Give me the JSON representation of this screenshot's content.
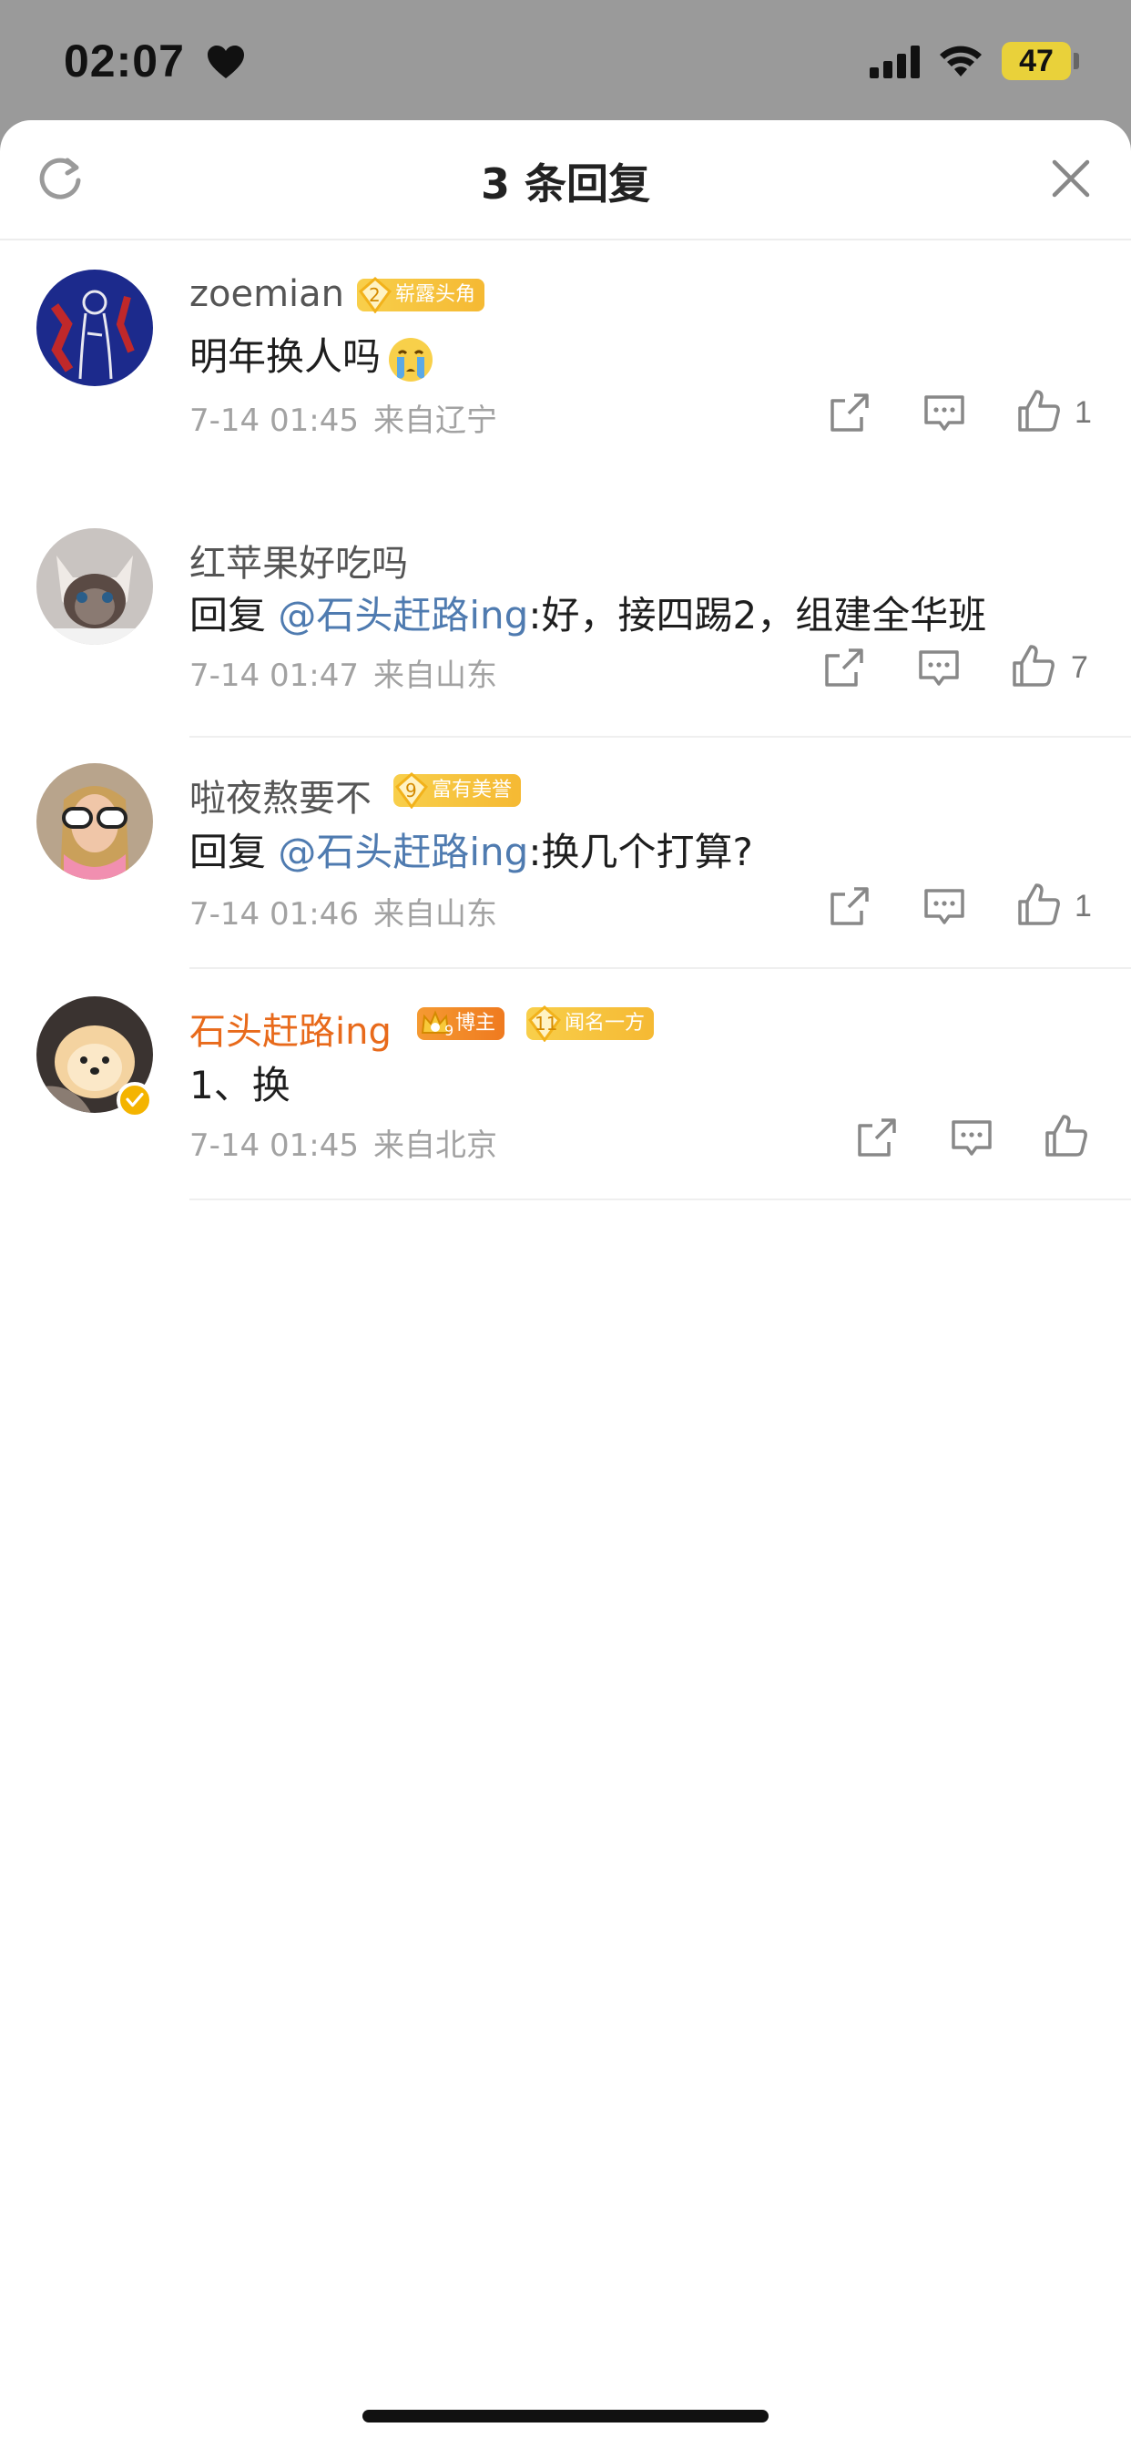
{
  "status_bar": {
    "time": "02:07",
    "battery": "47",
    "icons": [
      "heart-icon",
      "signal-icon",
      "wifi-icon",
      "battery-icon"
    ]
  },
  "header": {
    "title": "3 条回复",
    "refresh_icon": "refresh-icon",
    "close_icon": "close-icon"
  },
  "comments": [
    {
      "username": "zoemian",
      "badge": {
        "level": "2",
        "text": "崭露头角"
      },
      "content": "明年换人吗",
      "emoji": "crying-face",
      "time": "7-14 01:45",
      "location": "来自辽宁",
      "likes": "1"
    },
    {
      "username": "红苹果好吃吗",
      "reply_prefix": "回复",
      "mention": "@石头赶路ing",
      "content": ":好，接四踢2，组建全华班",
      "time": "7-14 01:47",
      "location": "来自山东",
      "likes": "7"
    },
    {
      "username": "啦夜熬要不",
      "badge": {
        "level": "9",
        "text": "富有美誉"
      },
      "reply_prefix": "回复",
      "mention": "@石头赶路ing",
      "content": ":换几个打算?",
      "time": "7-14 01:46",
      "location": "来自山东",
      "likes": "1"
    },
    {
      "username": "石头赶路ing",
      "badges": [
        {
          "level": "9",
          "text": "博主"
        },
        {
          "level": "11",
          "text": "闻名一方"
        }
      ],
      "content": "1、换",
      "time": "7-14 01:45",
      "location": "来自北京",
      "likes": ""
    }
  ],
  "colors": {
    "mention": "#4f7bb0",
    "author": "#e86a1b",
    "meta": "#a2a2a2",
    "badge_gold": "#f5b933",
    "badge_orange": "#ef7a1f"
  }
}
